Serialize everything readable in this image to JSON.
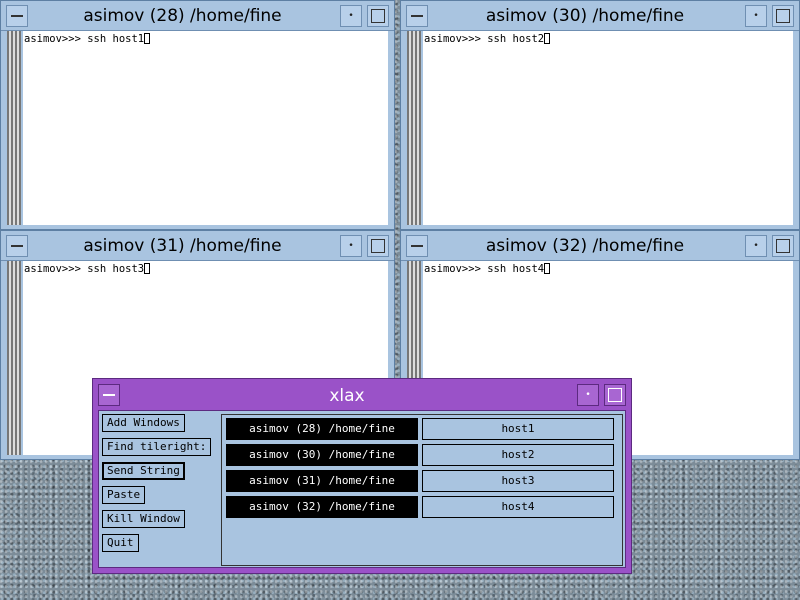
{
  "terminals": [
    {
      "title": "asimov (28) /home/fine",
      "prompt": "asimov>>> ssh host1"
    },
    {
      "title": "asimov (30) /home/fine",
      "prompt": "asimov>>> ssh host2"
    },
    {
      "title": "asimov (31) /home/fine",
      "prompt": "asimov>>> ssh host3"
    },
    {
      "title": "asimov (32) /home/fine",
      "prompt": "asimov>>> ssh host4"
    }
  ],
  "xlax": {
    "title": "xlax",
    "buttons": [
      "Add Windows",
      "Find tileright:",
      "Send String",
      "Paste",
      "Kill Window",
      "Quit"
    ],
    "windows": [
      {
        "name": "asimov (28) /home/fine",
        "host": "host1"
      },
      {
        "name": "asimov (30) /home/fine",
        "host": "host2"
      },
      {
        "name": "asimov (31) /home/fine",
        "host": "host3"
      },
      {
        "name": "asimov (32) /home/fine",
        "host": "host4"
      }
    ]
  },
  "icons": {
    "minimize": "•"
  },
  "colors": {
    "terminal_frame": "#a9c4e0",
    "xlax_frame": "#9a52c8",
    "selected_entry": "#000000"
  }
}
